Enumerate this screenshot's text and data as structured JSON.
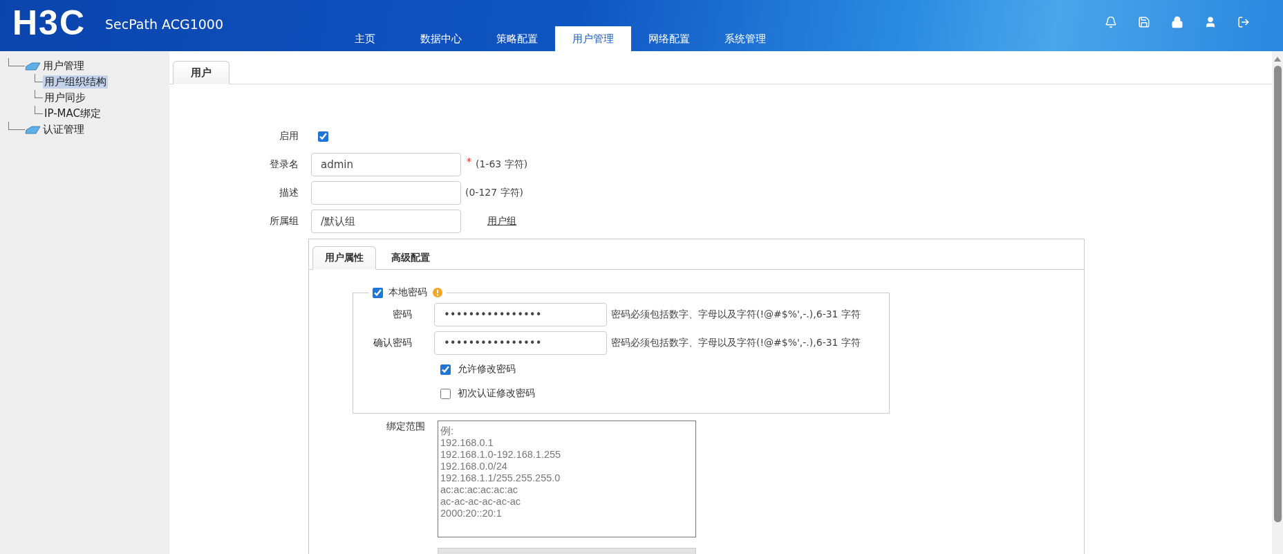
{
  "header": {
    "logo": "H3C",
    "product": "SecPath ACG1000",
    "nav": [
      {
        "label": "主页",
        "selected": false
      },
      {
        "label": "数据中心",
        "selected": false
      },
      {
        "label": "策略配置",
        "selected": false
      },
      {
        "label": "用户管理",
        "selected": true
      },
      {
        "label": "网络配置",
        "selected": false
      },
      {
        "label": "系统管理",
        "selected": false
      }
    ]
  },
  "sidebar": {
    "tree": [
      {
        "label": "用户管理",
        "selected": false,
        "children": [
          {
            "label": "用户组织结构",
            "selected": true
          },
          {
            "label": "用户同步",
            "selected": false
          },
          {
            "label": "IP-MAC绑定",
            "selected": false
          }
        ]
      },
      {
        "label": "认证管理",
        "selected": false
      }
    ]
  },
  "tabs": [
    {
      "label": "用户",
      "selected": true
    }
  ],
  "form": {
    "enable": {
      "label": "启用",
      "checked": true
    },
    "fields": [
      {
        "label": "登录名",
        "value": "admin",
        "required_mark": "*",
        "hint": "(1-63 字符)"
      },
      {
        "label": "描述",
        "hint": "(0-127 字符)"
      },
      {
        "label": "所属组",
        "value": "/默认组",
        "link": "用户组"
      }
    ]
  },
  "inner_tabs": [
    {
      "label": "用户属性",
      "selected": true
    },
    {
      "label": "高级配置",
      "selected": false
    }
  ],
  "local_password": {
    "label": "本地密码",
    "checked": true,
    "fields": [
      {
        "label": "密码",
        "value": "••••••••••••••••",
        "hint": "密码必须包括数字、字母以及字符(!@#$%',-.),6-31 字符"
      },
      {
        "label": "确认密码",
        "value": "••••••••••••••••",
        "hint": "密码必须包括数字、字母以及字符(!@#$%',-.),6-31 字符"
      }
    ],
    "options": [
      {
        "label": "允许修改密码",
        "checked": true
      },
      {
        "label": "初次认证修改密码",
        "checked": false
      }
    ]
  },
  "bind_range": {
    "label": "绑定范围",
    "placeholder": "例:\n192.168.0.1\n192.168.1.0-192.168.1.255\n192.168.0.0/24\n192.168.1.1/255.255.255.0\nac:ac:ac:ac:ac:ac\nac-ac-ac-ac-ac-ac\n2000:20::20:1"
  }
}
